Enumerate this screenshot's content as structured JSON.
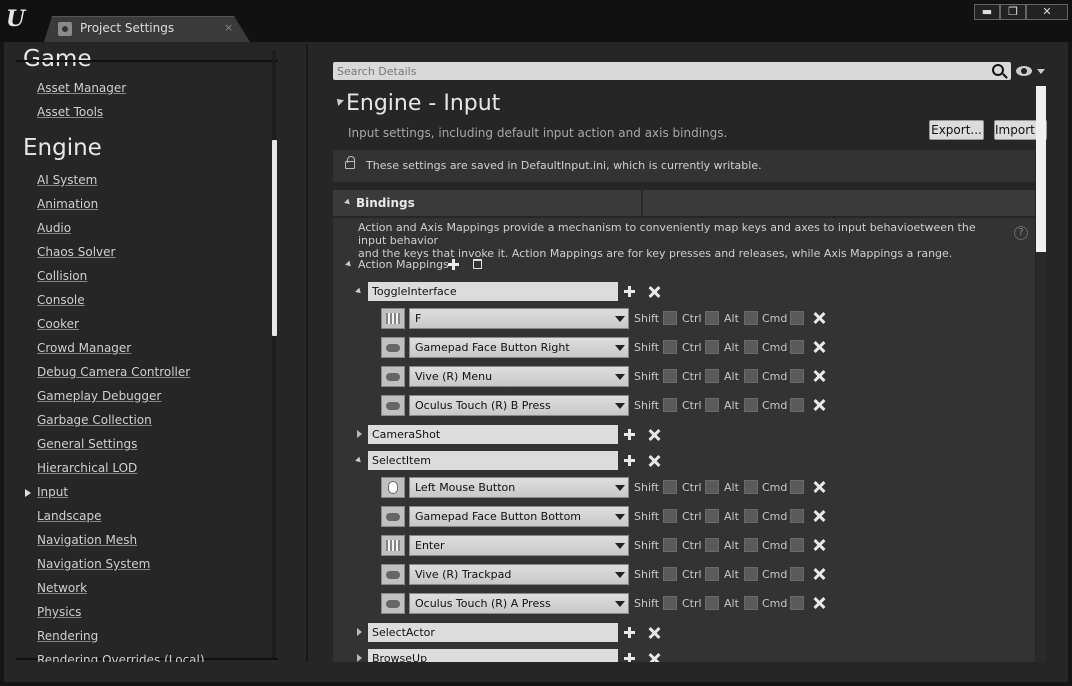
{
  "titlebar": {
    "tab_label": "Project Settings",
    "tab_close": "×",
    "minimize": "▬",
    "maximize": "❐",
    "close": "✕",
    "logo": "U"
  },
  "sidebar": {
    "game_heading": "Game",
    "game_items": [
      "Asset Manager",
      "Asset Tools"
    ],
    "engine_heading": "Engine",
    "engine_items": [
      "AI System",
      "Animation",
      "Audio",
      "Chaos Solver",
      "Collision",
      "Console",
      "Cooker",
      "Crowd Manager",
      "Debug Camera Controller",
      "Gameplay Debugger",
      "Garbage Collection",
      "General Settings",
      "Hierarchical LOD",
      "Input",
      "Landscape",
      "Navigation Mesh",
      "Navigation System",
      "Network",
      "Physics",
      "Rendering",
      "Rendering Overrides (Local)"
    ],
    "selected": "Input"
  },
  "search": {
    "placeholder": "Search Details"
  },
  "section": {
    "title": "Engine - Input",
    "description": "Input settings, including default input action and axis bindings.",
    "export_label": "Export...",
    "import_label": "Import..."
  },
  "notice": {
    "text": "These settings are saved in DefaultInput.ini, which is currently writable."
  },
  "bindings": {
    "label": "Bindings",
    "description_line1": "Action and Axis Mappings provide a mechanism to conveniently map keys and axes to input behavio\u0000etween the input behavior",
    "description_line2": "and the keys that invoke it. Action Mappings are for key presses and releases, while Axis Mappings a\u0000 range.",
    "help": "?",
    "action_mappings_label": "Action Mappings",
    "modifiers": [
      "Shift",
      "Ctrl",
      "Alt",
      "Cmd"
    ],
    "actions": [
      {
        "name": "ToggleInterface",
        "expanded": true,
        "keys": [
          {
            "key": "F",
            "icon": "keyboard-icon"
          },
          {
            "key": "Gamepad Face Button Right",
            "icon": "gamepad-icon"
          },
          {
            "key": "Vive (R) Menu",
            "icon": "gamepad-icon"
          },
          {
            "key": "Oculus Touch (R) B Press",
            "icon": "gamepad-icon"
          }
        ]
      },
      {
        "name": "CameraShot",
        "expanded": false,
        "keys": []
      },
      {
        "name": "SelectItem",
        "expanded": true,
        "keys": [
          {
            "key": "Left Mouse Button",
            "icon": "mouse-icon"
          },
          {
            "key": "Gamepad Face Button Bottom",
            "icon": "gamepad-icon"
          },
          {
            "key": "Enter",
            "icon": "keyboard-icon"
          },
          {
            "key": "Vive (R) Trackpad",
            "icon": "gamepad-icon"
          },
          {
            "key": "Oculus Touch (R) A Press",
            "icon": "gamepad-icon"
          }
        ]
      },
      {
        "name": "SelectActor",
        "expanded": false,
        "keys": []
      },
      {
        "name": "BrowseUp",
        "expanded": false,
        "keys": []
      }
    ]
  }
}
